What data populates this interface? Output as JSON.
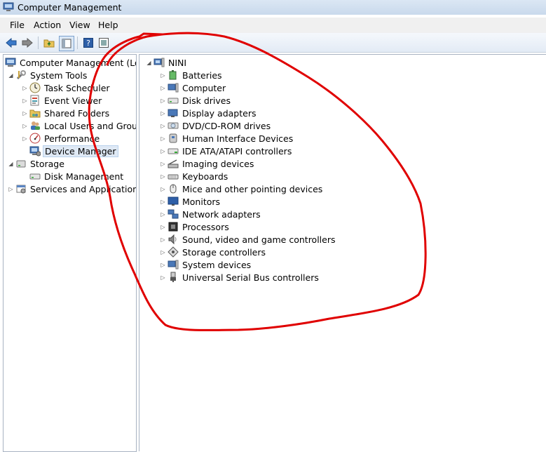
{
  "window": {
    "title": "Computer Management"
  },
  "menu": [
    "File",
    "Action",
    "View",
    "Help"
  ],
  "toolbar": {
    "buttons": [
      "back-arrow-icon",
      "forward-arrow-icon",
      "up-folder-icon",
      "show-hide-tree-icon",
      "help-icon",
      "console-view-icon"
    ]
  },
  "left_tree": {
    "root": "Computer Management (Local",
    "items": [
      {
        "label": "System Tools",
        "icon": "tools-icon"
      },
      {
        "label": "Task Scheduler",
        "icon": "clock-icon"
      },
      {
        "label": "Event Viewer",
        "icon": "event-viewer-icon"
      },
      {
        "label": "Shared Folders",
        "icon": "shared-folder-icon"
      },
      {
        "label": "Local Users and Groups",
        "icon": "users-icon"
      },
      {
        "label": "Performance",
        "icon": "performance-icon"
      },
      {
        "label": "Device Manager",
        "icon": "device-manager-icon",
        "selected": true
      },
      {
        "label": "Storage",
        "icon": "storage-icon"
      },
      {
        "label": "Disk Management",
        "icon": "disk-icon"
      },
      {
        "label": "Services and Applications",
        "icon": "services-icon"
      }
    ]
  },
  "device_tree": {
    "root": "NINI",
    "categories": [
      "Batteries",
      "Computer",
      "Disk drives",
      "Display adapters",
      "DVD/CD-ROM drives",
      "Human Interface Devices",
      "IDE ATA/ATAPI controllers",
      "Imaging devices",
      "Keyboards",
      "Mice and other pointing devices",
      "Monitors",
      "Network adapters",
      "Processors",
      "Sound, video and game controllers",
      "Storage controllers",
      "System devices",
      "Universal Serial Bus controllers"
    ]
  },
  "colors": {
    "annotation": "#e00000",
    "selection": "#dfe9f5",
    "titlebar": "#c9d9ec"
  }
}
